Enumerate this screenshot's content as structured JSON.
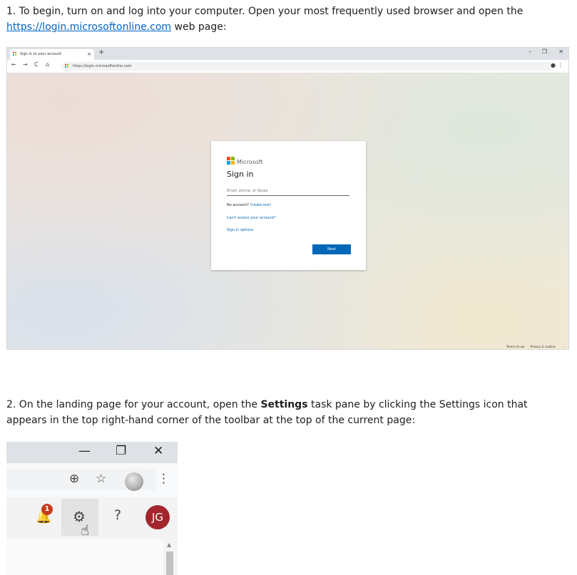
{
  "step1": {
    "text_before": "1. To begin, turn on and log into your computer. Open your most frequently used browser and open the",
    "link": "https://login.microsoftonline.com",
    "text_after": " web page:"
  },
  "browser": {
    "tab_title": "Sign in to your account",
    "tab_close": "×",
    "new_tab": "+",
    "minimize": "–",
    "restore": "❐",
    "close": "✕",
    "back": "←",
    "forward": "→",
    "reload": "C",
    "home": "⌂",
    "url": "https://login.microsoftonline.com",
    "profile_icon": "●",
    "menu_icon": "⋮"
  },
  "signin": {
    "brand": "Microsoft",
    "title": "Sign in",
    "placeholder": "Email, phone, or Skype",
    "no_account": "No account?",
    "create": "Create one!",
    "cant_access": "Can't access your account?",
    "options": "Sign-in options",
    "next": "Next",
    "terms": "Terms of use",
    "privacy": "Privacy & cookies",
    "more": "..."
  },
  "step2": {
    "text_before": "2. On the landing page for your account, open the ",
    "bold": "Settings",
    "text_after": " task pane by clicking the Settings icon that appears in the top right-hand corner of the toolbar at the top of the current page:"
  },
  "toolbar": {
    "minimize": "—",
    "restore": "❐",
    "close": "✕",
    "add_icon": "⊕",
    "star_icon": "☆",
    "menu_icon": "⋮",
    "notification_count": "1",
    "bell_icon": "🔔",
    "gear_icon": "⚙",
    "hand_icon": "☝",
    "help": "?",
    "initials": "JG",
    "scroll_up": "▲"
  },
  "colors": {
    "link": "#0563c1",
    "ms_blue": "#0067b8",
    "avatar": "#a4262c",
    "badge": "#c43e1c"
  }
}
